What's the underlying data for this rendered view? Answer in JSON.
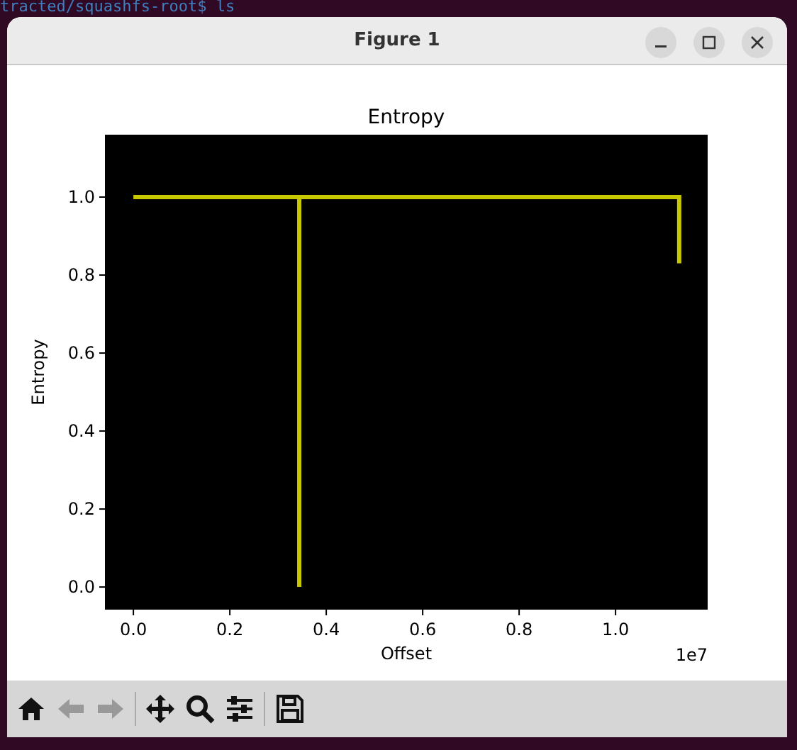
{
  "terminal_text": "tracted/squashfs-root$ ls",
  "window": {
    "title": "Figure 1"
  },
  "figure": {
    "axis_multiplier": "1e7",
    "chart_data": {
      "type": "line",
      "title": "Entropy",
      "xlabel": "Offset",
      "ylabel": "Entropy",
      "x": [
        0,
        0.344,
        0.344,
        0.344,
        1.132,
        1.132
      ],
      "series": [
        {
          "color": "#c8c800",
          "values": [
            1,
            1,
            0,
            1,
            1,
            0.83
          ]
        }
      ],
      "xlim": [
        -0.059,
        1.191
      ],
      "ylim": [
        -0.058,
        1.16
      ],
      "xticks": [
        {
          "value": 0,
          "label": "0.0"
        },
        0.2,
        0.4,
        0.6,
        0.8,
        {
          "value": 1,
          "label": "1.0"
        }
      ],
      "yticks": [
        {
          "value": 0,
          "label": "0.0"
        },
        0.2,
        0.4,
        0.6,
        0.8,
        {
          "value": 1,
          "label": "1.0"
        }
      ]
    }
  },
  "toolbar": [
    {
      "kind": "home"
    },
    {
      "kind": "back"
    },
    {
      "kind": "forward"
    },
    {
      "kind": "sep"
    },
    {
      "kind": "pan"
    },
    {
      "kind": "zoom"
    },
    {
      "kind": "configure"
    },
    {
      "kind": "sep"
    },
    {
      "kind": "save"
    }
  ]
}
